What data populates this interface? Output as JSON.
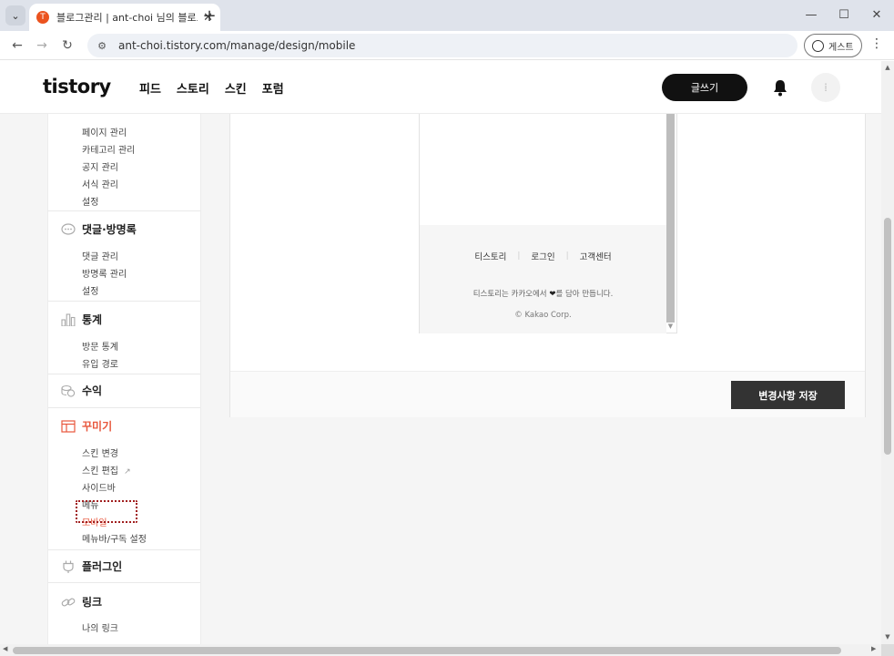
{
  "browser": {
    "tab_title": "블로그관리 | ant-choi 님의 블로그",
    "url": "ant-choi.tistory.com/manage/design/mobile",
    "profile_label": "게스트"
  },
  "header": {
    "logo": "tistory",
    "nav": [
      "피드",
      "스토리",
      "스킨",
      "포럼"
    ],
    "write_label": "글쓰기"
  },
  "sidebar": {
    "content_items": [
      "페이지 관리",
      "카테고리 관리",
      "공지 관리",
      "서식 관리",
      "설정"
    ],
    "comments": {
      "title": "댓글·방명록",
      "items": [
        "댓글 관리",
        "방명록 관리",
        "설정"
      ]
    },
    "stats": {
      "title": "통계",
      "items": [
        "방문 통계",
        "유입 경로"
      ]
    },
    "revenue": {
      "title": "수익"
    },
    "decorate": {
      "title": "꾸미기",
      "items": [
        "스킨 변경",
        "스킨 편집",
        "사이드바",
        "메뉴",
        "모바일",
        "메뉴바/구독 설정"
      ]
    },
    "plugin": {
      "title": "플러그인"
    },
    "link": {
      "title": "링크",
      "items": [
        "나의 링크"
      ]
    }
  },
  "preview": {
    "footer_links": [
      "티스토리",
      "로그인",
      "고객센터"
    ],
    "made_prefix": "티스토리는 카카오에서",
    "made_suffix": "를 담아 만듭니다.",
    "copyright": "© Kakao Corp."
  },
  "save_label": "변경사항 저장",
  "colors": {
    "accent": "#e8573d",
    "dark_button": "#333333",
    "write_button": "#111111"
  }
}
